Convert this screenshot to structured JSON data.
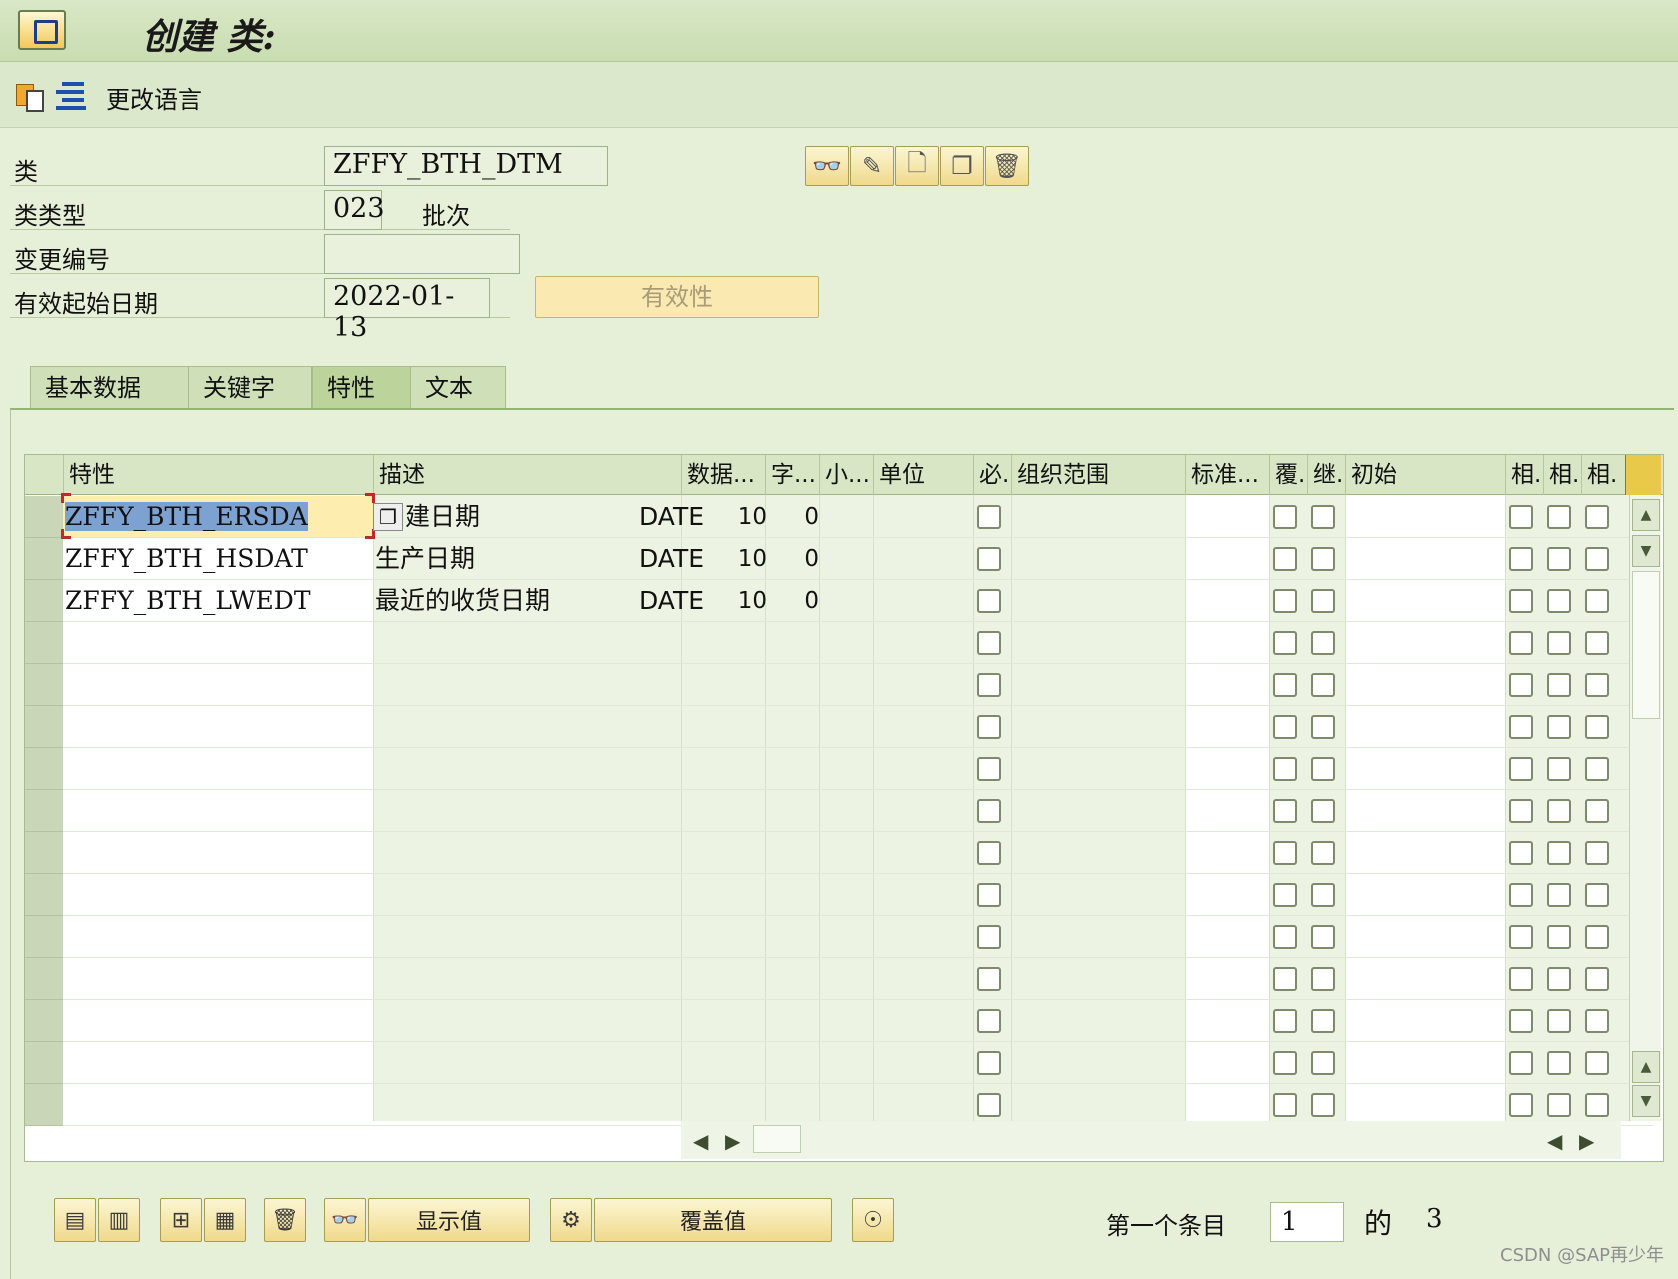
{
  "window": {
    "title": "创建 类:"
  },
  "toolbar": {
    "change_language_label": "更改语言"
  },
  "header": {
    "class_label": "类",
    "class_value": "ZFFY_BTH_DTM",
    "class_type_label": "类类型",
    "class_type_value": "023",
    "class_type_desc": "批次",
    "change_number_label": "变更编号",
    "change_number_value": "",
    "valid_from_label": "有效起始日期",
    "valid_from_value": "2022-01-13",
    "validity_button_label": "有效性"
  },
  "tabs": [
    {
      "label": "基本数据",
      "active": false
    },
    {
      "label": "关键字",
      "active": false
    },
    {
      "label": "特性",
      "active": true
    },
    {
      "label": "文本",
      "active": false
    }
  ],
  "grid": {
    "columns": [
      "特性",
      "描述",
      "数据...",
      "字...",
      "小...",
      "单位",
      "必.",
      "组织范围",
      "标准...",
      "覆.",
      "继.",
      "初始",
      "相.",
      "相.",
      "相."
    ],
    "rows": [
      {
        "characteristic": "ZFFY_BTH_ERSDA",
        "description": "建日期",
        "data_type": "DATE",
        "chars": "10",
        "decimals": "0"
      },
      {
        "characteristic": "ZFFY_BTH_HSDAT",
        "description": "生产日期",
        "data_type": "DATE",
        "chars": "10",
        "decimals": "0"
      },
      {
        "characteristic": "ZFFY_BTH_LWEDT",
        "description": "最近的收货日期",
        "data_type": "DATE",
        "chars": "10",
        "decimals": "0"
      }
    ],
    "empty_rows": 12
  },
  "bottom": {
    "display_values_label": "显示值",
    "overwrite_values_label": "覆盖值",
    "first_entry_label": "第一个条目",
    "first_entry_value": "1",
    "of_label": "的",
    "total": "3"
  },
  "watermark": "CSDN @SAP再少年",
  "colors": {
    "background": "#e6f0d8",
    "button": "#f0d98c",
    "selection": "#7da1d1",
    "focus_cell": "#fdeeb0"
  }
}
